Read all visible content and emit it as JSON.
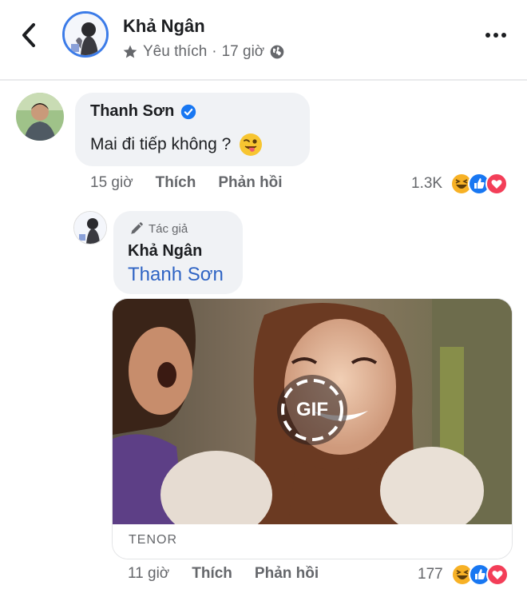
{
  "header": {
    "back_icon": "chevron-left-icon",
    "title": "Khả Ngân",
    "favorite_label": "Yêu thích",
    "separator": "·",
    "time": "17 giờ",
    "privacy_icon": "globe-icon",
    "more_icon": "more-horizontal-icon"
  },
  "comments": [
    {
      "author": "Thanh Sơn",
      "verified": true,
      "text": "Mai đi tiếp không ?",
      "emoji": "😜",
      "time": "15 giờ",
      "like_label": "Thích",
      "reply_label": "Phản hồi",
      "reaction_count": "1.3K",
      "reactions": [
        "haha",
        "like",
        "love"
      ]
    }
  ],
  "reply": {
    "author_badge": "Tác giả",
    "author": "Khả Ngân",
    "mention": "Thanh Sơn",
    "gif_label": "GIF",
    "gif_source": "TENOR",
    "time": "11 giờ",
    "like_label": "Thích",
    "reply_label": "Phản hồi",
    "reaction_count": "177",
    "reactions": [
      "haha",
      "like",
      "love"
    ]
  },
  "colors": {
    "accent_blue": "#1877f2",
    "mention_blue": "#2f64c4",
    "love_red": "#f33e58",
    "haha_yellow": "#f7b125"
  }
}
